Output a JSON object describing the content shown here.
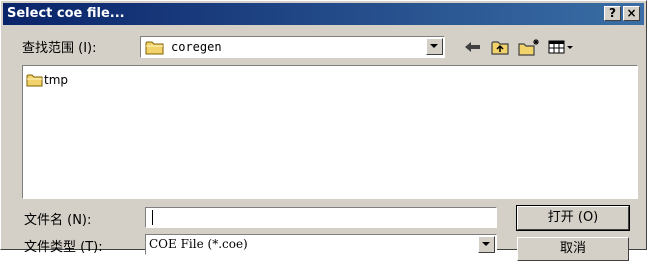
{
  "window": {
    "title": "Select coe file...",
    "help_label": "?",
    "close_label": "×"
  },
  "toolbar": {
    "look_in_label": "查找范围 (I):",
    "look_in_value": "coregen",
    "icons": [
      "folder-icon",
      "back-arrow-icon",
      "up-folder-icon",
      "new-folder-icon",
      "view-menu-icon"
    ]
  },
  "file_list": {
    "items": [
      {
        "name": "tmp",
        "icon": "folder-icon"
      }
    ]
  },
  "form": {
    "file_name_label": "文件名 (N):",
    "file_name_value": "",
    "file_type_label": "文件类型 (T):",
    "file_type_value": "COE File (*.coe)"
  },
  "buttons": {
    "open_label": "打开 (O)",
    "cancel_label": "取消"
  },
  "colors": {
    "title_gradient_start": "#0a246a",
    "title_gradient_end": "#3a6ea5",
    "face": "#d4d0c8",
    "folder": "#f2d36b"
  }
}
